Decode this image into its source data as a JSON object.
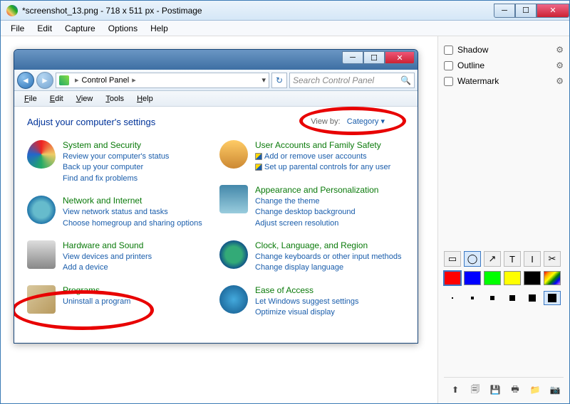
{
  "outer": {
    "title": "*screenshot_13.png - 718 x 511 px - Postimage",
    "menu": [
      "File",
      "Edit",
      "Capture",
      "Options",
      "Help"
    ]
  },
  "rightPanel": {
    "options": [
      "Shadow",
      "Outline",
      "Watermark"
    ],
    "tools": [
      "rect",
      "ellipse",
      "arrow",
      "text",
      "caret",
      "crop"
    ],
    "activeTool": 1,
    "colors": [
      "#ff0000",
      "#0000ff",
      "#00ff00",
      "#ffff00",
      "#000000",
      "rainbow"
    ],
    "activeColor": 0,
    "activeSize": 5,
    "bottomIcons": [
      "upload",
      "save",
      "disk",
      "print",
      "folder",
      "camera"
    ]
  },
  "inner": {
    "breadcrumb": "Control Panel",
    "searchPlaceholder": "Search Control Panel",
    "menu": [
      "File",
      "Edit",
      "View",
      "Tools",
      "Help"
    ],
    "heading": "Adjust your computer's settings",
    "viewby_label": "View by:",
    "viewby_value": "Category",
    "left": [
      {
        "title": "System and Security",
        "subs": [
          "Review your computer's status",
          "Back up your computer",
          "Find and fix problems"
        ]
      },
      {
        "title": "Network and Internet",
        "subs": [
          "View network status and tasks",
          "Choose homegroup and sharing options"
        ]
      },
      {
        "title": "Hardware and Sound",
        "subs": [
          "View devices and printers",
          "Add a device"
        ]
      },
      {
        "title": "Programs",
        "subs": [
          "Uninstall a program"
        ]
      }
    ],
    "right": [
      {
        "title": "User Accounts and Family Safety",
        "subs": [
          "Add or remove user accounts",
          "Set up parental controls for any user"
        ],
        "shield": true
      },
      {
        "title": "Appearance and Personalization",
        "subs": [
          "Change the theme",
          "Change desktop background",
          "Adjust screen resolution"
        ]
      },
      {
        "title": "Clock, Language, and Region",
        "subs": [
          "Change keyboards or other input methods",
          "Change display language"
        ]
      },
      {
        "title": "Ease of Access",
        "subs": [
          "Let Windows suggest settings",
          "Optimize visual display"
        ]
      }
    ]
  }
}
